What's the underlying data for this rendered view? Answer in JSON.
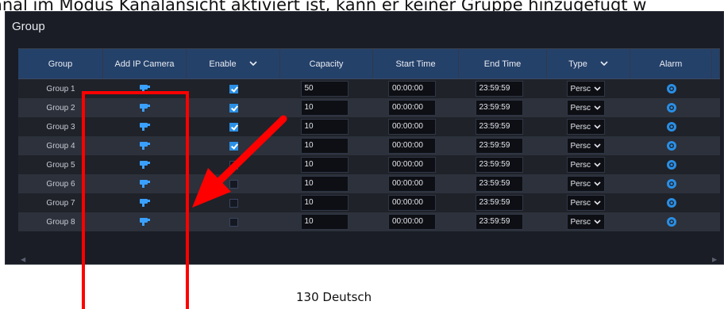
{
  "caption": "anal im Modus Kanalansicht aktiviert ist, kann er keiner Gruppe hinzugefügt w",
  "panel": {
    "title": "Group"
  },
  "columns": {
    "group": "Group",
    "add_camera": "Add IP Camera",
    "enable": "Enable",
    "capacity": "Capacity",
    "start_time": "Start Time",
    "end_time": "End Time",
    "type": "Type",
    "alarm": "Alarm"
  },
  "rows": [
    {
      "name": "Group 1",
      "enabled": true,
      "capacity": "50",
      "start": "00:00:00",
      "end": "23:59:59",
      "type": "Persc"
    },
    {
      "name": "Group 2",
      "enabled": true,
      "capacity": "10",
      "start": "00:00:00",
      "end": "23:59:59",
      "type": "Persc"
    },
    {
      "name": "Group 3",
      "enabled": true,
      "capacity": "10",
      "start": "00:00:00",
      "end": "23:59:59",
      "type": "Persc"
    },
    {
      "name": "Group 4",
      "enabled": true,
      "capacity": "10",
      "start": "00:00:00",
      "end": "23:59:59",
      "type": "Persc"
    },
    {
      "name": "Group 5",
      "enabled": false,
      "capacity": "10",
      "start": "00:00:00",
      "end": "23:59:59",
      "type": "Persc"
    },
    {
      "name": "Group 6",
      "enabled": false,
      "capacity": "10",
      "start": "00:00:00",
      "end": "23:59:59",
      "type": "Persc"
    },
    {
      "name": "Group 7",
      "enabled": false,
      "capacity": "10",
      "start": "00:00:00",
      "end": "23:59:59",
      "type": "Persc"
    },
    {
      "name": "Group 8",
      "enabled": false,
      "capacity": "10",
      "start": "00:00:00",
      "end": "23:59:59",
      "type": "Persc"
    }
  ],
  "footer": "130 Deutsch",
  "colors": {
    "header": "#24416a",
    "accent": "#2a8fe6",
    "annotation": "#ff0000"
  },
  "icons": {
    "add_camera": "camera-icon",
    "alarm": "gear-icon",
    "dropdown": "chevron-down-icon"
  }
}
